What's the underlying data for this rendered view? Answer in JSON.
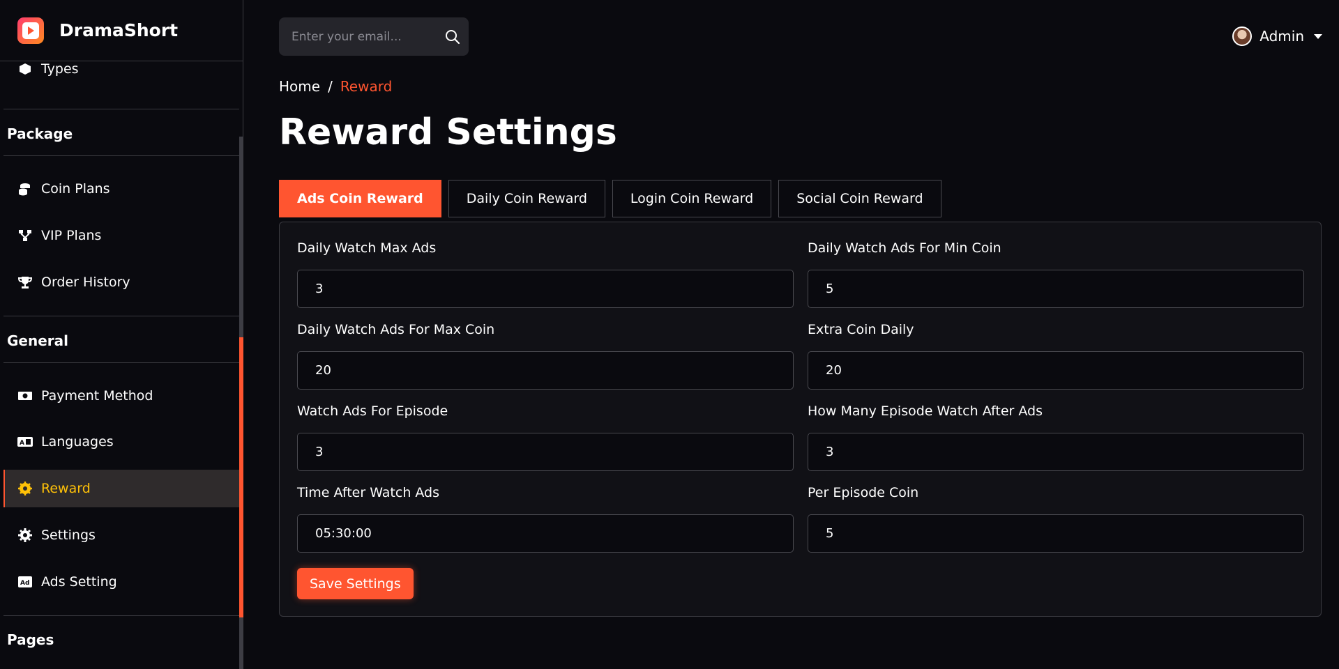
{
  "brand": {
    "name": "DramaShort"
  },
  "sidebar": {
    "partial_item": "Types",
    "sections": [
      {
        "title": "Package",
        "items": [
          "Coin Plans",
          "VIP Plans",
          "Order History"
        ]
      },
      {
        "title": "General",
        "items": [
          "Payment Method",
          "Languages",
          "Reward",
          "Settings",
          "Ads Setting"
        ]
      },
      {
        "title": "Pages",
        "items": []
      }
    ],
    "active_item": "Reward"
  },
  "search": {
    "placeholder": "Enter your email..."
  },
  "user": {
    "name": "Admin"
  },
  "breadcrumb": {
    "home": "Home",
    "separator": "/",
    "current": "Reward"
  },
  "page": {
    "title": "Reward Settings"
  },
  "tabs": [
    "Ads Coin Reward",
    "Daily Coin Reward",
    "Login Coin Reward",
    "Social Coin Reward"
  ],
  "active_tab": "Ads Coin Reward",
  "form": {
    "fields": [
      {
        "label": "Daily Watch Max Ads",
        "value": "3"
      },
      {
        "label": "Daily Watch Ads For Min Coin",
        "value": "5"
      },
      {
        "label": "Daily Watch Ads For Max Coin",
        "value": "20"
      },
      {
        "label": "Extra Coin Daily",
        "value": "20"
      },
      {
        "label": "Watch Ads For Episode",
        "value": "3"
      },
      {
        "label": "How Many Episode Watch After Ads",
        "value": "3"
      },
      {
        "label": "Time After Watch Ads",
        "value": "05:30:00"
      },
      {
        "label": "Per Episode Coin",
        "value": "5"
      }
    ],
    "save_label": "Save Settings"
  },
  "colors": {
    "accent": "#ff5530",
    "active_text": "#ffc107",
    "background": "#0a0a0f",
    "card": "#111116"
  }
}
